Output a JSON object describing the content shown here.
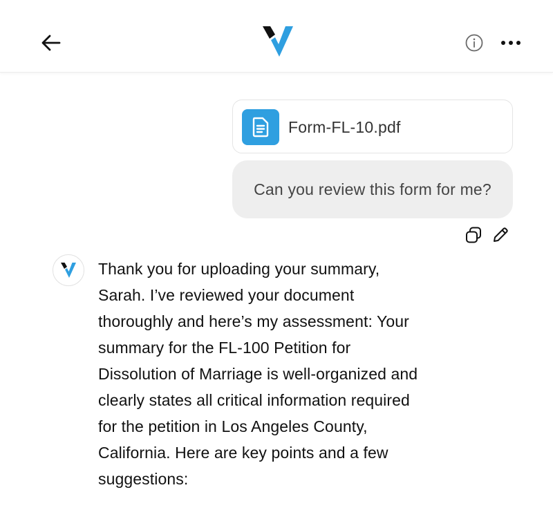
{
  "header": {
    "back_icon": "arrow-left-icon",
    "logo_icon": "v-logo-icon",
    "info_icon": "info-circle-icon",
    "more_icon": "more-horizontal-icon",
    "logo_color_dark": "#111111",
    "logo_color_accent": "#2f9fe0"
  },
  "conversation": {
    "attachment": {
      "icon": "document-icon",
      "file_name": "Form-FL-10.pdf",
      "icon_bg_color": "#2f9fe0"
    },
    "user_message": {
      "text": "Can you review this form for me?",
      "actions": {
        "copy_icon": "copy-icon",
        "edit_icon": "pencil-icon"
      }
    },
    "assistant_message": {
      "avatar_icon": "v-logo-icon",
      "text": "Thank you for uploading your summary, Sarah. I’ve reviewed your document thoroughly and here’s my assessment: Your summary for the FL-100 Petition for Dissolution of Marriage is well-organized and clearly states all critical information required for the petition in Los Angeles County, California. Here are key points and a few suggestions:"
    }
  }
}
